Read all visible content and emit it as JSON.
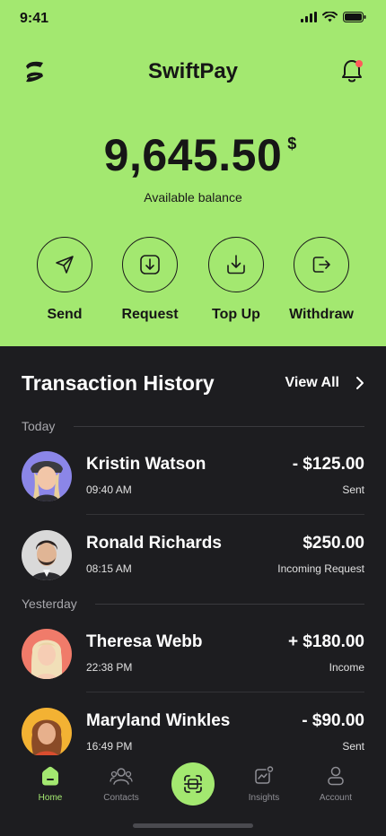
{
  "status_bar": {
    "time": "9:41"
  },
  "app": {
    "title": "SwiftPay"
  },
  "balance": {
    "amount": "9,645.50",
    "currency": "$",
    "label": "Available balance"
  },
  "actions": [
    {
      "label": "Send",
      "icon": "send-icon"
    },
    {
      "label": "Request",
      "icon": "request-icon"
    },
    {
      "label": "Top Up",
      "icon": "top-up-icon"
    },
    {
      "label": "Withdraw",
      "icon": "withdraw-icon"
    }
  ],
  "history": {
    "title": "Transaction History",
    "view_all": "View All",
    "sections": [
      {
        "label": "Today",
        "items": [
          {
            "name": "Kristin Watson",
            "time": "09:40 AM",
            "amount": "- $125.00",
            "status": "Sent",
            "avatar_color": "#8b86e8"
          },
          {
            "name": "Ronald Richards",
            "time": "08:15 AM",
            "amount": "$250.00",
            "status": "Incoming Request",
            "avatar_color": "#d9d9d9"
          }
        ]
      },
      {
        "label": "Yesterday",
        "items": [
          {
            "name": "Theresa Webb",
            "time": "22:38 PM",
            "amount": "+ $180.00",
            "status": "Income",
            "avatar_color": "#f07b6a"
          },
          {
            "name": "Maryland Winkles",
            "time": "16:49 PM",
            "amount": "- $90.00",
            "status": "Sent",
            "avatar_color": "#f3b233"
          }
        ]
      }
    ]
  },
  "nav": [
    {
      "label": "Home",
      "icon": "home-icon",
      "active": true
    },
    {
      "label": "Contacts",
      "icon": "contacts-icon"
    },
    {
      "label": "",
      "icon": "scan-icon"
    },
    {
      "label": "Insights",
      "icon": "insights-icon"
    },
    {
      "label": "Account",
      "icon": "account-icon"
    }
  ],
  "colors": {
    "accent": "#a3e870",
    "dark_bg": "#1d1d20"
  }
}
